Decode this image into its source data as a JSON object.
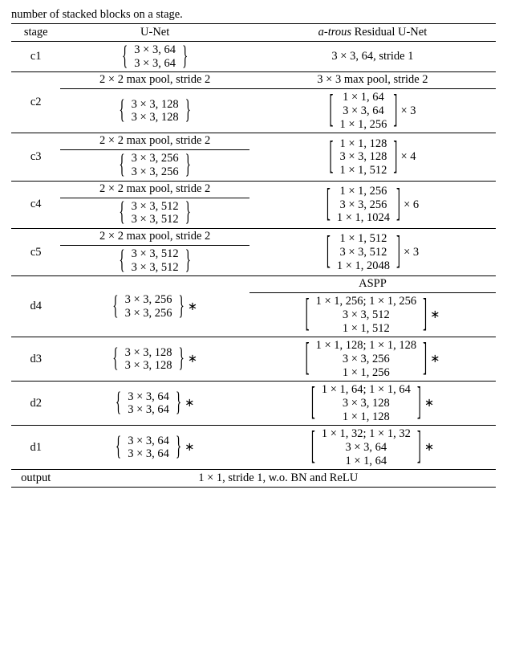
{
  "caption_fragment": "number of stacked blocks on a stage.",
  "headers": {
    "stage": "stage",
    "unet": "U-Net",
    "res": "<i>a-trous</i> Residual U-Net"
  },
  "pool22": "2 × 2 max pool, stride 2",
  "pool33": "3 × 3 max pool, stride 2",
  "aspp": "ASPP",
  "output_label": "output",
  "output_text": "1 × 1, stride 1, w.o. BN and ReLU",
  "times3": "× 3",
  "times4": "× 4",
  "times6": "× 6",
  "star": "∗",
  "stages": {
    "c1": {
      "name": "c1",
      "u": [
        "3 × 3, 64",
        "3 × 3, 64"
      ],
      "resSingle": "3 × 3, 64, stride 1"
    },
    "c2": {
      "name": "c2",
      "u": [
        "3 × 3, 128",
        "3 × 3, 128"
      ],
      "r": [
        "1 × 1, 64",
        "3 × 3, 64",
        "1 × 1, 256"
      ],
      "mult": "times3"
    },
    "c3": {
      "name": "c3",
      "u": [
        "3 × 3, 256",
        "3 × 3, 256"
      ],
      "r": [
        "1 × 1, 128",
        "3 × 3, 128",
        "1 × 1, 512"
      ],
      "mult": "times4"
    },
    "c4": {
      "name": "c4",
      "u": [
        "3 × 3, 512",
        "3 × 3, 512"
      ],
      "r": [
        "1 × 1, 256",
        "3 × 3, 256",
        "1 × 1, 1024"
      ],
      "mult": "times6"
    },
    "c5": {
      "name": "c5",
      "u": [
        "3 × 3, 512",
        "3 × 3, 512"
      ],
      "r": [
        "1 × 1, 512",
        "3 × 3, 512",
        "1 × 1, 2048"
      ],
      "mult": "times3"
    },
    "d4": {
      "name": "d4",
      "u": [
        "3 × 3, 256",
        "3 × 3, 256"
      ],
      "r": [
        "1 × 1, 256; 1 × 1, 256",
        "3 × 3, 512",
        "1 × 1, 512"
      ]
    },
    "d3": {
      "name": "d3",
      "u": [
        "3 × 3, 128",
        "3 × 3, 128"
      ],
      "r": [
        "1 × 1, 128; 1 × 1, 128",
        "3 × 3, 256",
        "1 × 1, 256"
      ]
    },
    "d2": {
      "name": "d2",
      "u": [
        "3 × 3, 64",
        "3 × 3, 64"
      ],
      "r": [
        "1 × 1, 64; 1 × 1, 64",
        "3 × 3, 128",
        "1 × 1, 128"
      ]
    },
    "d1": {
      "name": "d1",
      "u": [
        "3 × 3, 64",
        "3 × 3, 64"
      ],
      "r": [
        "1 × 1, 32; 1 × 1, 32",
        "3 × 3, 64",
        "1 × 1, 64"
      ]
    }
  }
}
